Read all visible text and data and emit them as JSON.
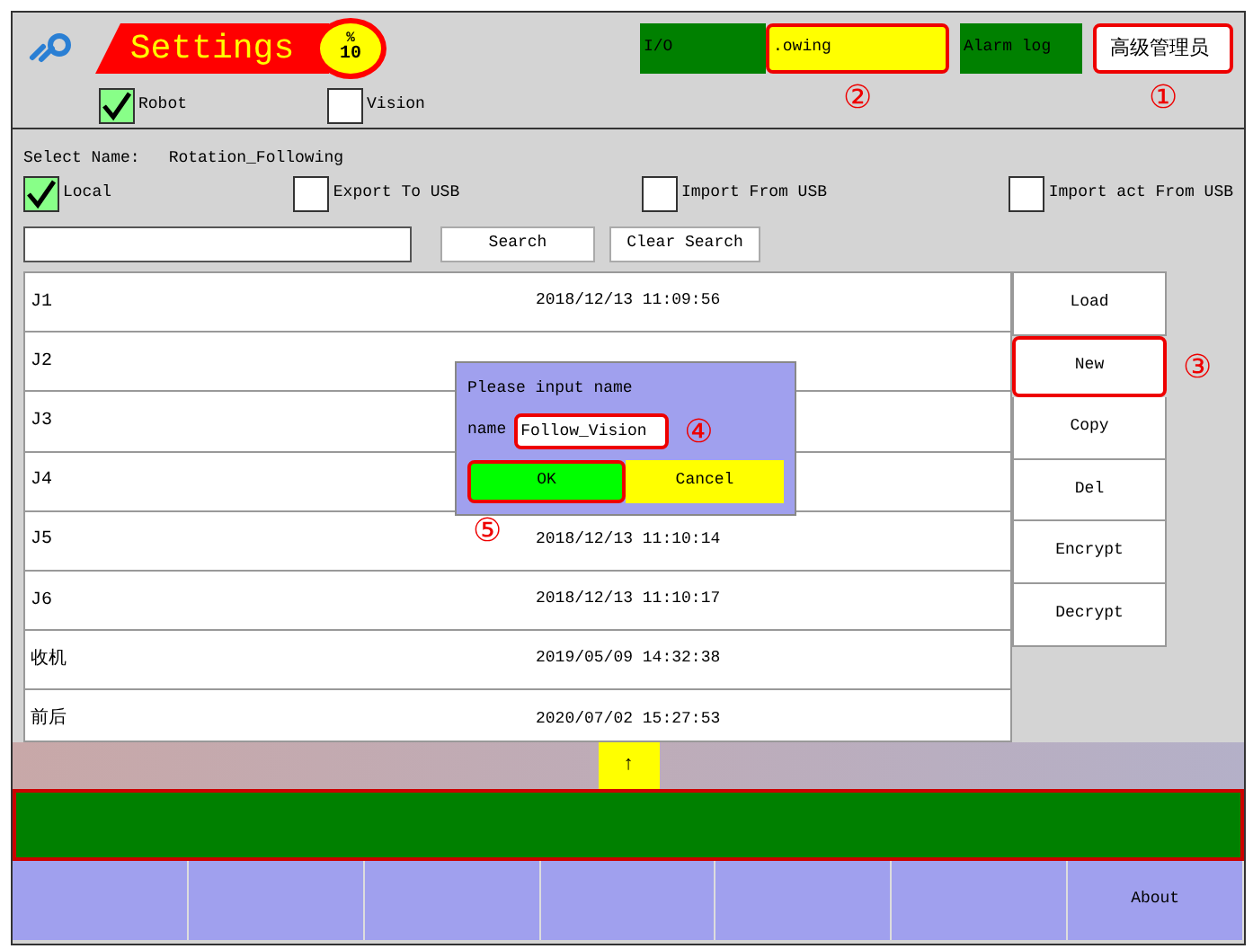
{
  "header": {
    "title": "Settings",
    "gauge": {
      "unit": "%",
      "value": "10"
    },
    "status_blocks": [
      {
        "label": "I/O",
        "kind": "green",
        "highlighted": false
      },
      {
        "label": ".owing",
        "kind": "yellow",
        "highlighted": true,
        "callout": "②"
      },
      {
        "label": "Alarm log",
        "kind": "green",
        "highlighted": false
      },
      {
        "label": "高级管理员",
        "kind": "white",
        "highlighted": true,
        "callout": "①"
      }
    ]
  },
  "mode_checks": [
    {
      "label": "Robot",
      "checked": true
    },
    {
      "label": "Vision",
      "checked": false
    }
  ],
  "select_name": {
    "label": "Select Name:",
    "value": "Rotation_Following"
  },
  "source_checks": [
    {
      "label": "Local",
      "checked": true
    },
    {
      "label": "Export To USB",
      "checked": false
    },
    {
      "label": "Import From USB",
      "checked": false
    },
    {
      "label": "Import act From USB",
      "checked": false
    }
  ],
  "search": {
    "button": "Search",
    "clear_button": "Clear Search"
  },
  "rows": [
    {
      "name": "J1",
      "time": "2018/12/13 11:09:56"
    },
    {
      "name": "J2"
    },
    {
      "name": "J3"
    },
    {
      "name": "J4"
    },
    {
      "name": "J5",
      "time": "2018/12/13 11:10:14"
    },
    {
      "name": "J6",
      "time": "2018/12/13 11:10:17"
    },
    {
      "name": "收机",
      "time": "2019/05/09 14:32:38"
    },
    {
      "name": "前后",
      "time": "2020/07/02 15:27:53"
    }
  ],
  "actions": [
    {
      "label": "Load",
      "highlighted": false
    },
    {
      "label": "New",
      "highlighted": true,
      "callout": "③"
    },
    {
      "label": "Copy",
      "highlighted": false
    },
    {
      "label": "Del",
      "highlighted": false
    },
    {
      "label": "Encrypt",
      "highlighted": false
    },
    {
      "label": "Decrypt",
      "highlighted": false
    }
  ],
  "scroll_button": "↑",
  "bottom_tabs": [
    {
      "kind": "blank"
    },
    {
      "kind": "blank"
    },
    {
      "kind": "blank"
    },
    {
      "kind": "blank"
    },
    {
      "kind": "blank"
    },
    {
      "kind": "blank"
    },
    {
      "kind": "labeled",
      "label": "About"
    }
  ],
  "dialog": {
    "prompt": "Please input name",
    "field_label": "name",
    "value": "Follow_Vision",
    "field_highlighted": true,
    "field_callout": "④",
    "ok": "OK",
    "ok_highlighted": true,
    "ok_callout": "⑤",
    "cancel": "Cancel"
  }
}
